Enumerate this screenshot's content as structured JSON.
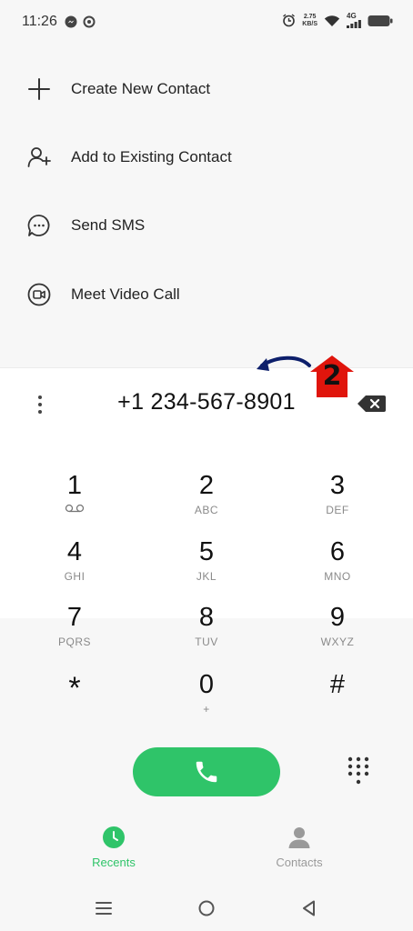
{
  "status_bar": {
    "time": "11:26",
    "net_speed_value": "2.75",
    "net_speed_unit": "KB/S",
    "network_type": "4G"
  },
  "menu": {
    "items": [
      {
        "label": "Create New Contact",
        "icon": "plus-icon"
      },
      {
        "label": "Add to Existing Contact",
        "icon": "add-person-icon"
      },
      {
        "label": "Send SMS",
        "icon": "chat-bubble-icon"
      },
      {
        "label": "Meet Video Call",
        "icon": "video-call-icon"
      }
    ]
  },
  "dialer": {
    "number": "+1 234-567-8901",
    "annotation_step": "2"
  },
  "keypad": {
    "keys": [
      {
        "digit": "1",
        "letters": ""
      },
      {
        "digit": "2",
        "letters": "ABC"
      },
      {
        "digit": "3",
        "letters": "DEF"
      },
      {
        "digit": "4",
        "letters": "GHI"
      },
      {
        "digit": "5",
        "letters": "JKL"
      },
      {
        "digit": "6",
        "letters": "MNO"
      },
      {
        "digit": "7",
        "letters": "PQRS"
      },
      {
        "digit": "8",
        "letters": "TUV"
      },
      {
        "digit": "9",
        "letters": "WXYZ"
      },
      {
        "digit": "*",
        "letters": ""
      },
      {
        "digit": "0",
        "letters": "+"
      },
      {
        "digit": "#",
        "letters": ""
      }
    ]
  },
  "tabs": [
    {
      "label": "Recents",
      "active": true
    },
    {
      "label": "Contacts",
      "active": false
    }
  ],
  "colors": {
    "accent_green": "#2fc469",
    "annotation_red": "#e0150c",
    "arrow_blue": "#0d1f6b",
    "inactive_gray": "#9a9a9a"
  }
}
